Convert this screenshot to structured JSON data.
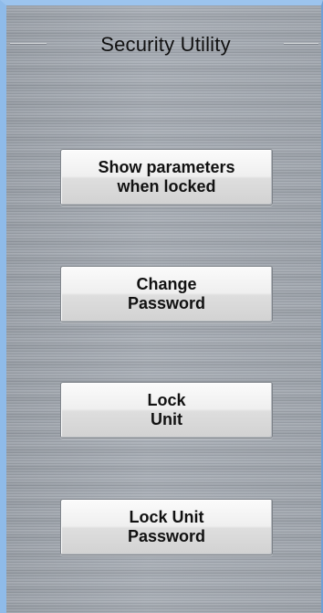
{
  "group": {
    "title": "Security Utility"
  },
  "buttons": [
    {
      "label": "Show parameters\nwhen locked"
    },
    {
      "label": "Change\nPassword"
    },
    {
      "label": "Lock\nUnit"
    },
    {
      "label": "Lock Unit\nPassword"
    }
  ],
  "colors": {
    "window_frame": "#8fbbe9",
    "panel": "#a1a7af",
    "button_face": "#efefef",
    "text": "#111111"
  }
}
